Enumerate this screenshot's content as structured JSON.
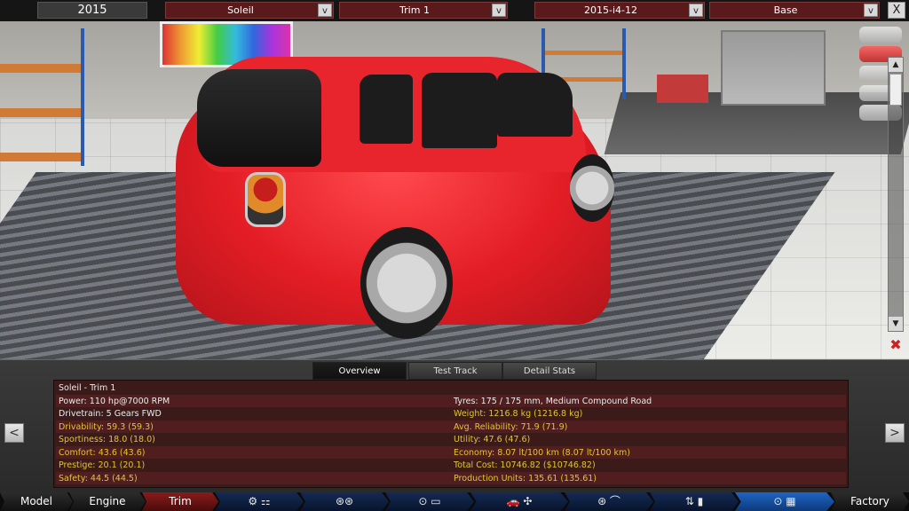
{
  "header": {
    "year": "2015",
    "model": "Soleil",
    "trim": "Trim 1",
    "engine_variant": "2015-i4-12",
    "variant": "Base",
    "dropdown_button": "v",
    "close_button": "X"
  },
  "tabs": [
    {
      "label": "Overview"
    },
    {
      "label": "Test Track"
    },
    {
      "label": "Detail Stats"
    }
  ],
  "stats": {
    "title": "Soleil - Trim 1",
    "left": [
      {
        "text": "Power: 110 hp@7000 RPM"
      },
      {
        "text": "Drivetrain: 5 Gears FWD"
      },
      {
        "text": "Drivability: 59.3 (59.3)"
      },
      {
        "text": "Sportiness: 18.0 (18.0)"
      },
      {
        "text": "Comfort: 43.6 (43.6)"
      },
      {
        "text": "Prestige: 20.1 (20.1)"
      },
      {
        "text": "Safety: 44.5 (44.5)"
      }
    ],
    "right": [
      {
        "text": "Tyres: 175 / 175 mm, Medium Compound Road"
      },
      {
        "text": "Weight: 1216.8 kg (1216.8 kg)"
      },
      {
        "text": "Avg. Reliability: 71.9 (71.9)"
      },
      {
        "text": "Utility: 47.6 (47.6)"
      },
      {
        "text": "Economy: 8.07 lt/100 km (8.07 lt/100 km)"
      },
      {
        "text": "Total Cost: 10746.82 ($10746.82)"
      },
      {
        "text": "Production Units: 135.61 (135.61)"
      }
    ]
  },
  "arrows": {
    "prev": "<",
    "next": ">"
  },
  "nav": [
    {
      "label": "Model"
    },
    {
      "label": "Engine"
    },
    {
      "label": "Trim"
    },
    {
      "label": "⚙ ⚏"
    },
    {
      "label": "⊛⊛"
    },
    {
      "label": "⊙ ▭"
    },
    {
      "label": "🚗 ✣"
    },
    {
      "label": "⊛ ⌒"
    },
    {
      "label": "⇅ ▮"
    },
    {
      "label": "⊙ ▦"
    },
    {
      "label": "Factory"
    }
  ],
  "colors": {
    "accent_red": "#e41d25",
    "stat_yellow": "#e3c532",
    "nav_blue": "#142a55"
  }
}
